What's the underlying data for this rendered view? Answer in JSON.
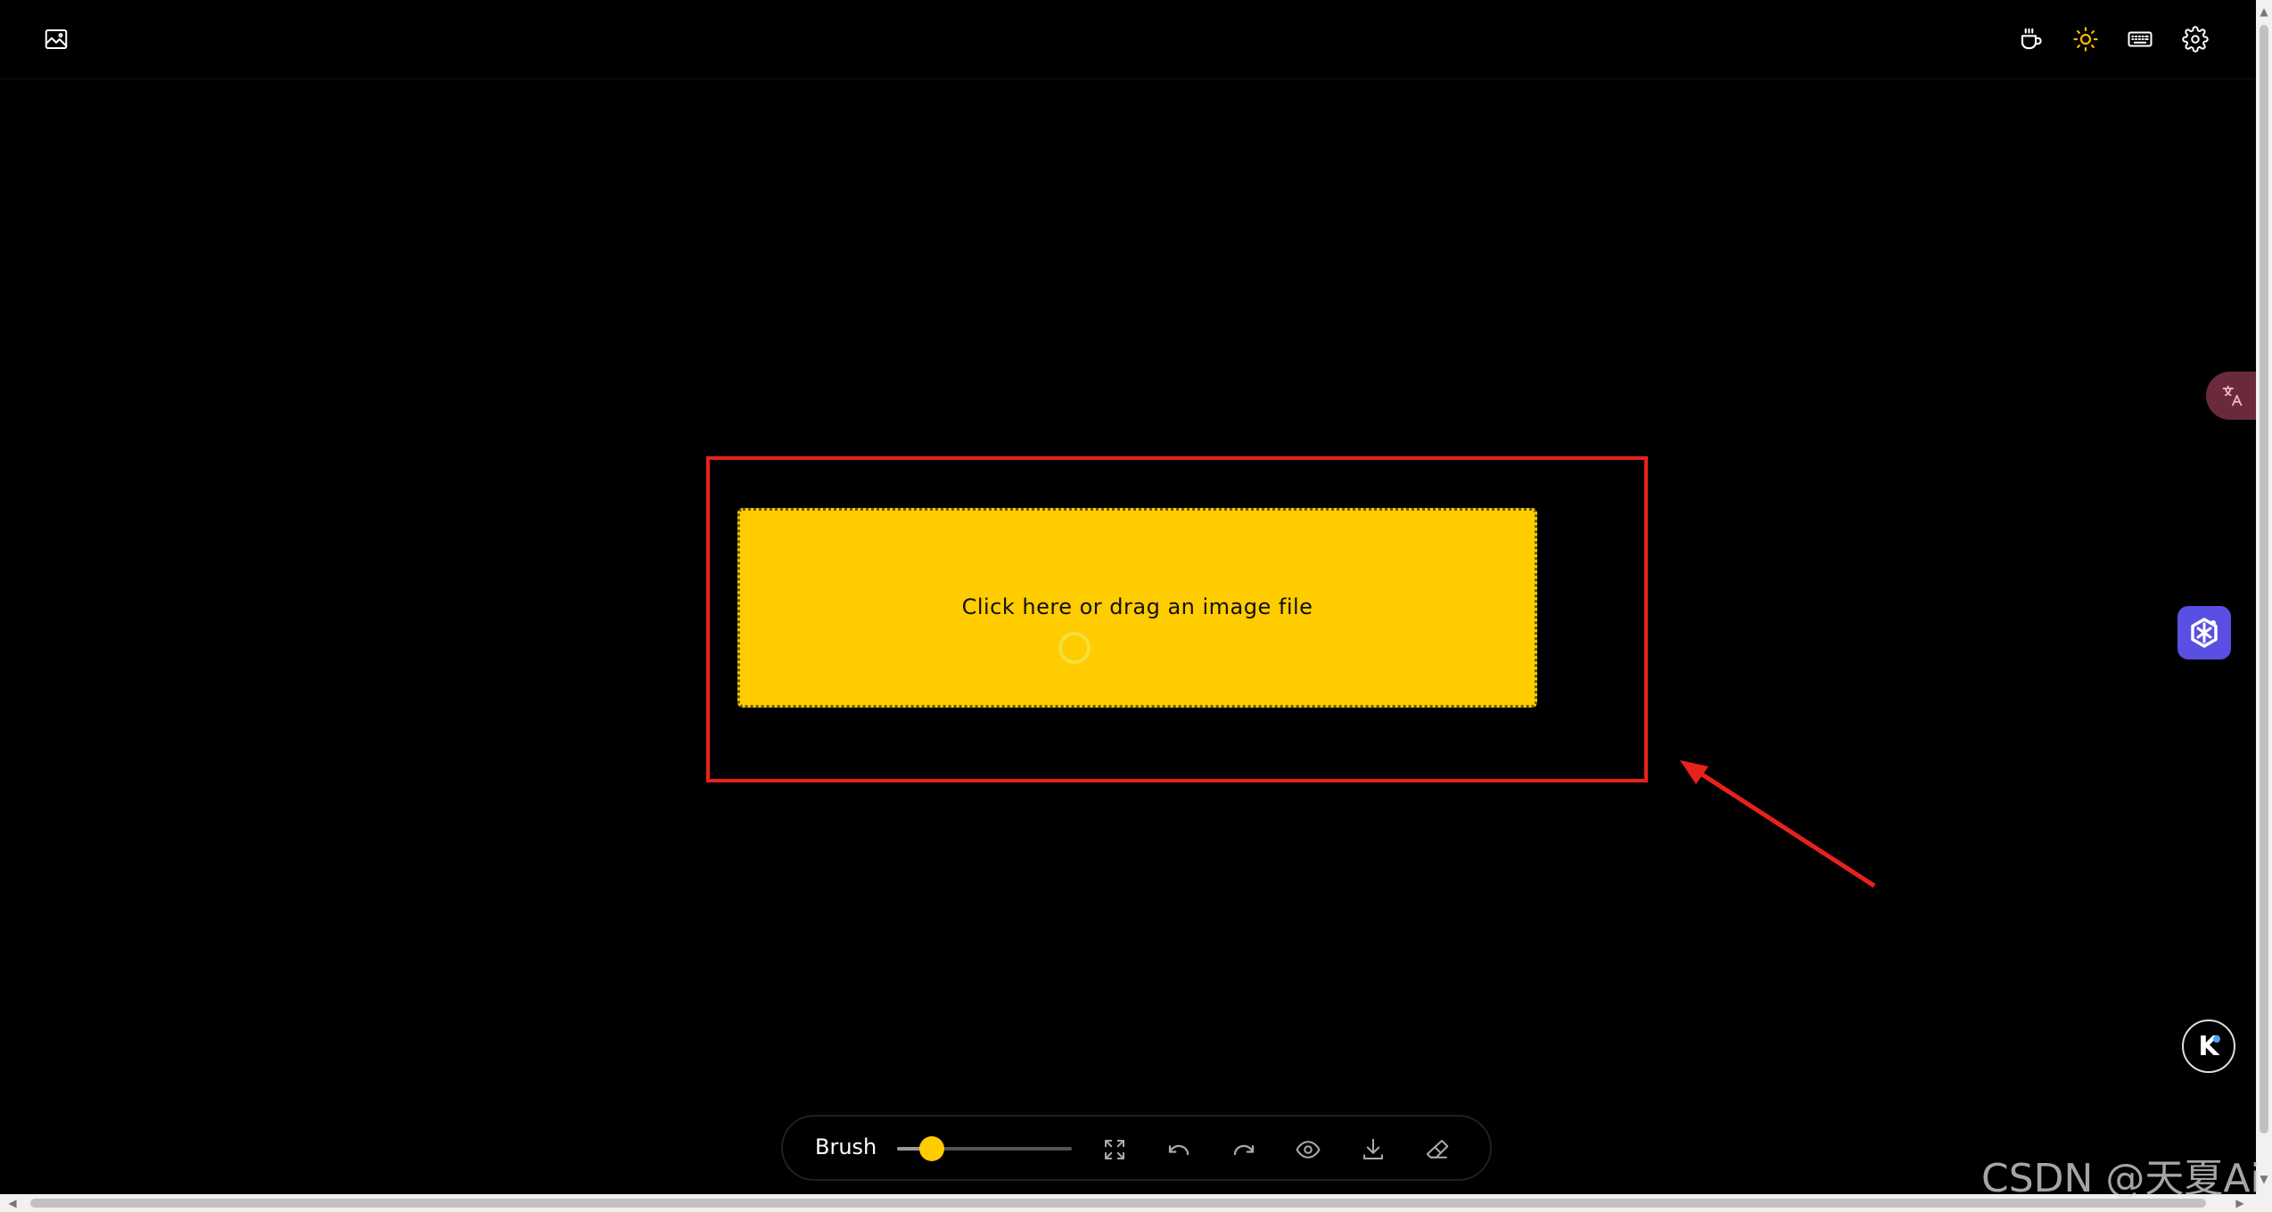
{
  "header": {
    "left_icon": "image-icon",
    "right_icons": [
      "coffee-icon",
      "sun-icon",
      "keyboard-icon",
      "gear-icon"
    ]
  },
  "dropzone": {
    "text": "Click here or drag an image file",
    "background": "#ffcc00"
  },
  "annotation": {
    "frame_color": "#e8221b"
  },
  "toolbar": {
    "brush_label": "Brush",
    "brush_size_fraction": 0.2,
    "tools": [
      "fullscreen-icon",
      "undo-icon",
      "redo-icon",
      "eye-icon",
      "download-icon",
      "eraser-icon"
    ]
  },
  "floating": {
    "translate_icon": "translate-icon",
    "plugin_icon": "plugin-icon",
    "k_label": "K"
  },
  "watermark": "CSDN @天夏Ai"
}
